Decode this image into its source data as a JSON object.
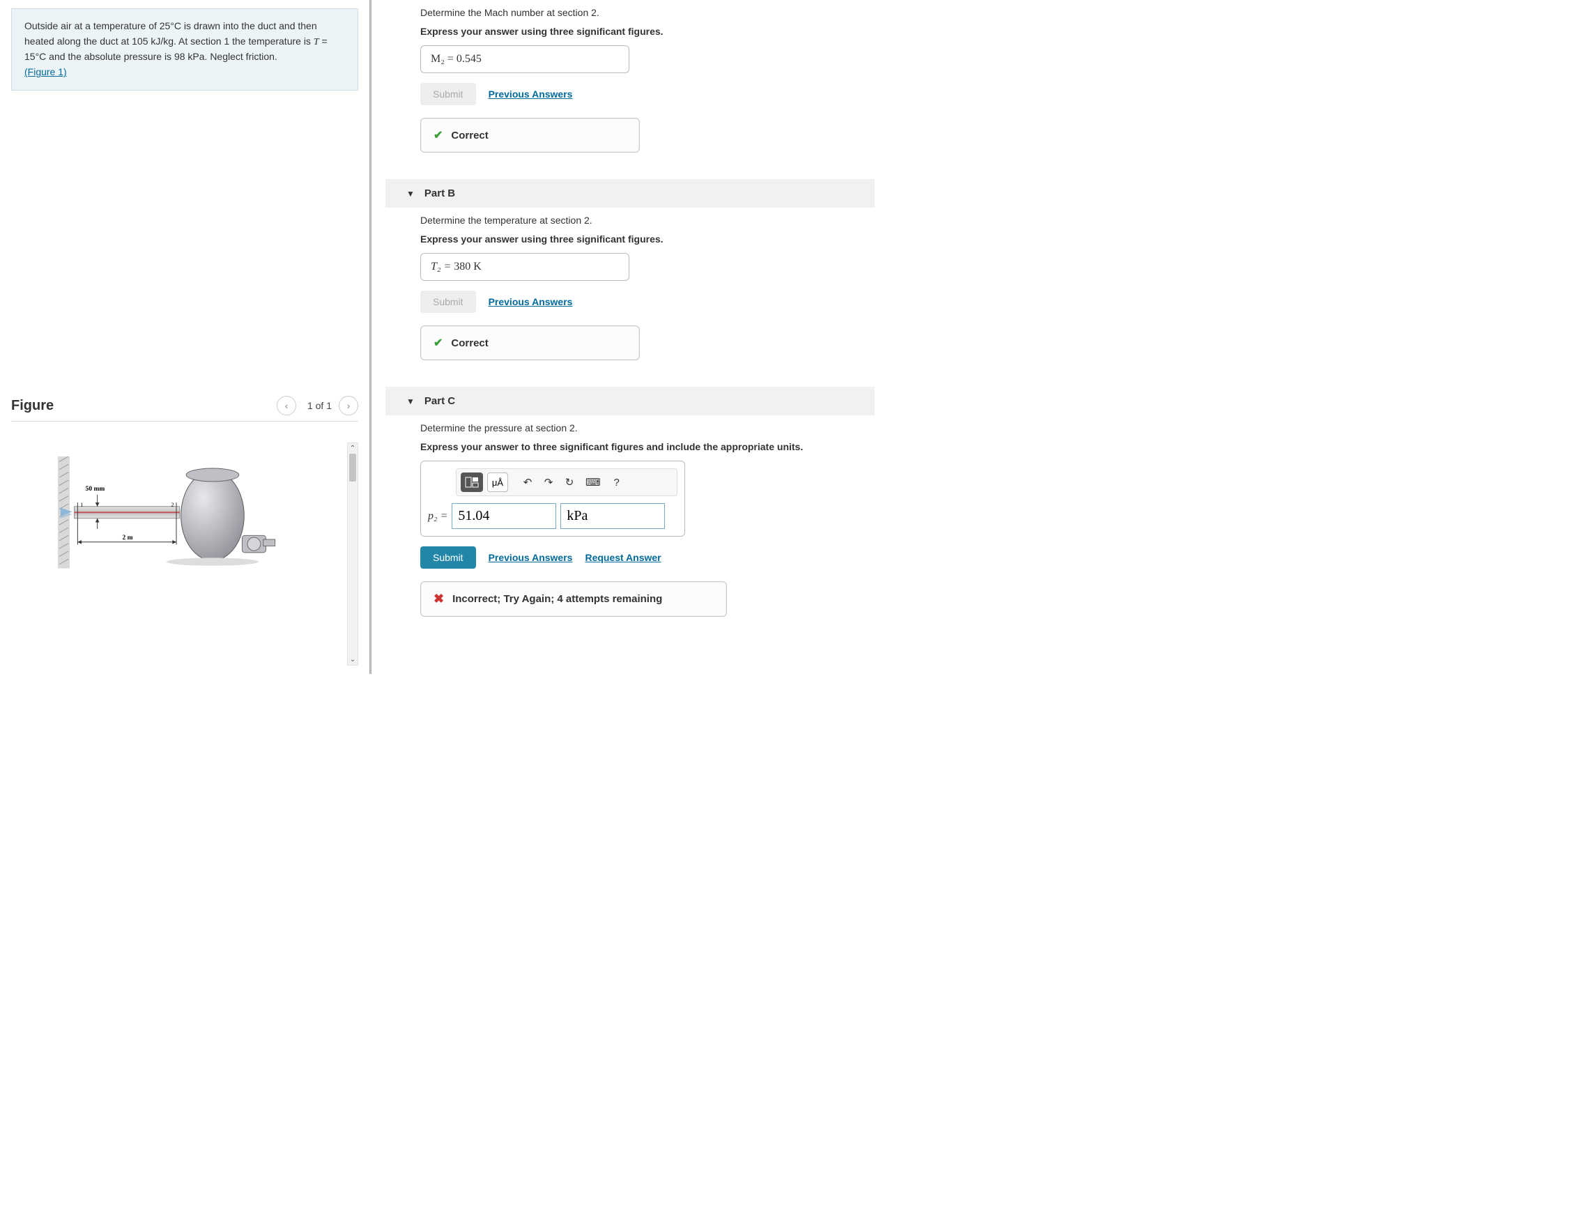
{
  "problem": {
    "text_before": "Outside air at a temperature of 25°C is drawn into the duct and then heated along the duct at 105 kJ/kg. At section 1 the temperature is",
    "var_T": "T",
    "eq": " = 15°C and the absolute pressure is 98 kPa. Neglect friction.",
    "figure_link": "(Figure 1)"
  },
  "figure": {
    "title": "Figure",
    "counter": "1 of 1",
    "label_50mm": "50 mm",
    "label_2m": "2 m",
    "label_1": "1",
    "label_2": "2"
  },
  "partA": {
    "prompt": "Determine the Mach number at section 2.",
    "instruction": "Express your answer using three significant figures.",
    "answer_lhs": "M₂ = ",
    "answer_val": "0.545",
    "submit": "Submit",
    "prev": "Previous Answers",
    "feedback": "Correct"
  },
  "partB": {
    "header": "Part B",
    "prompt": "Determine the temperature at section 2.",
    "instruction": "Express your answer using three significant figures.",
    "answer_lhs": "T₂ = ",
    "answer_val": "380",
    "answer_unit": " K",
    "submit": "Submit",
    "prev": "Previous Answers",
    "feedback": "Correct"
  },
  "partC": {
    "header": "Part C",
    "prompt": "Determine the pressure at section 2.",
    "instruction": "Express your answer to three significant figures and include the appropriate units.",
    "lhs": "p₂ = ",
    "value": "51.04",
    "unit": "kPa",
    "submit": "Submit",
    "prev": "Previous Answers",
    "request": "Request Answer",
    "feedback": "Incorrect; Try Again; 4 attempts remaining",
    "tool_units": "μÅ",
    "tool_help": "?"
  }
}
